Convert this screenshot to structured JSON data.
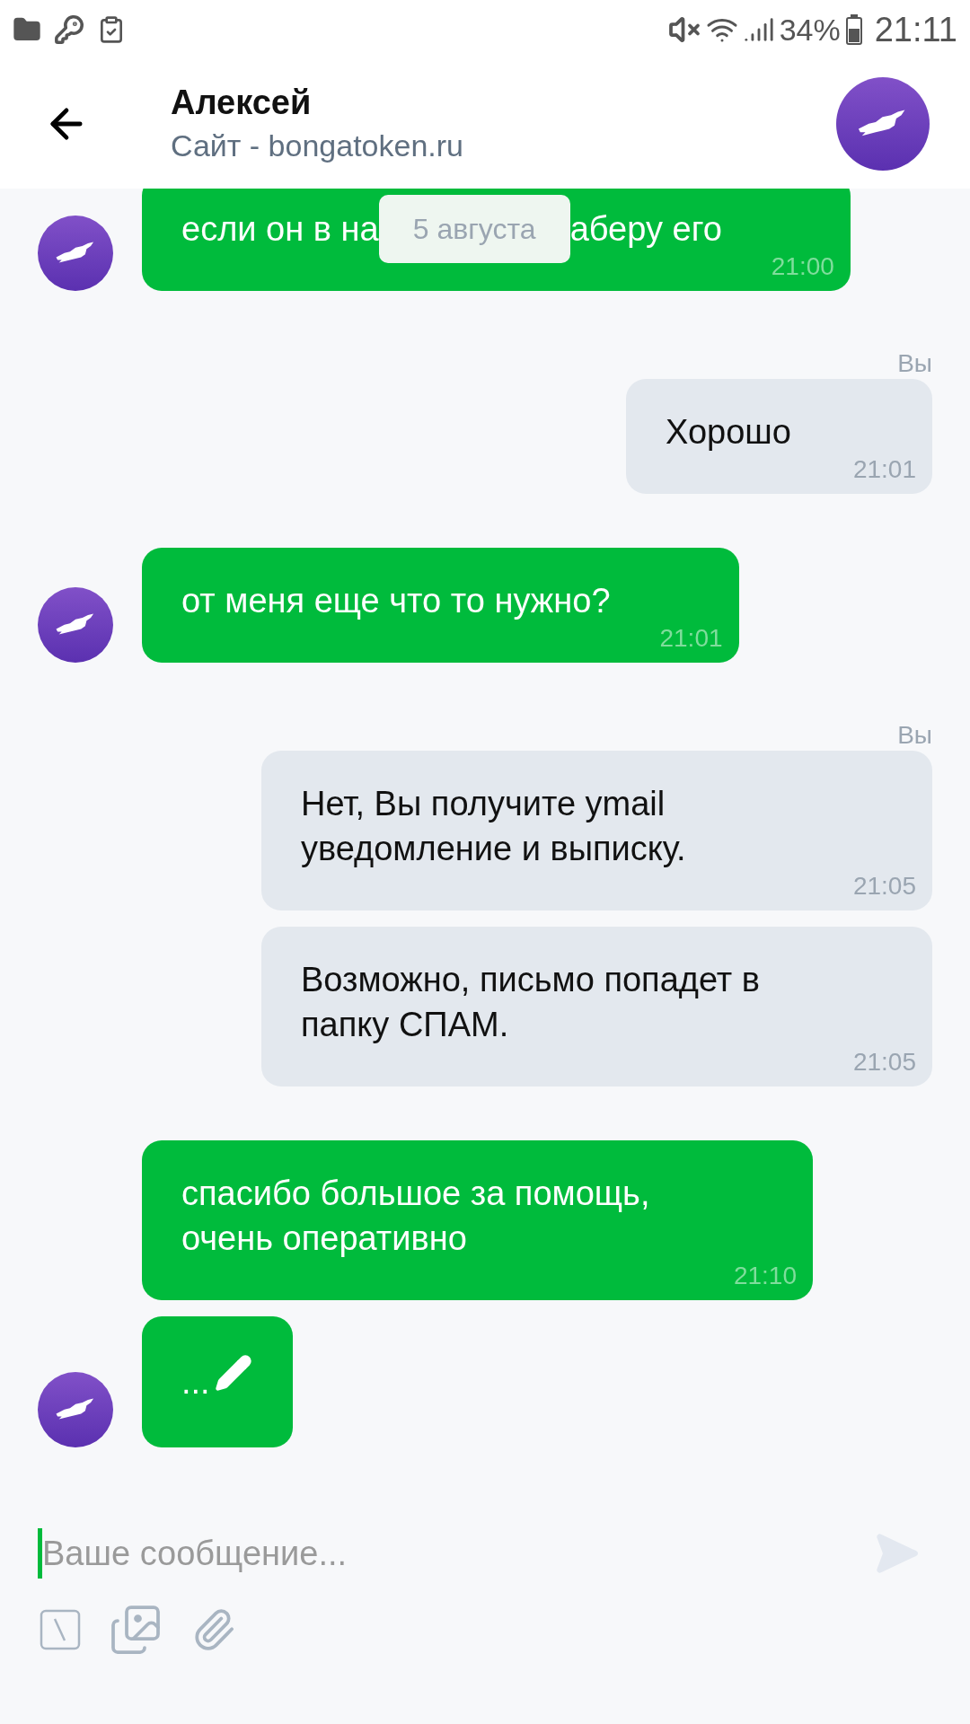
{
  "status_bar": {
    "battery": "34%",
    "time": "21:11"
  },
  "header": {
    "name": "Алексей",
    "subtitle": "Сайт - bongatoken.ru"
  },
  "date_chip": "5 августа",
  "messages": [
    {
      "kind": "incoming",
      "text_parts": [
        "если он в на",
        "аберу его"
      ],
      "time": "21:00",
      "avatar": true
    },
    {
      "kind": "outgoing",
      "sender": "Вы",
      "text": "Хорошо",
      "time": "21:01"
    },
    {
      "kind": "incoming",
      "text": "от меня еще что то нужно?",
      "time": "21:01",
      "avatar": true
    },
    {
      "kind": "outgoing",
      "sender": "Вы",
      "text": "Нет, Вы получите ymail уведомление и выписку.",
      "time": "21:05"
    },
    {
      "kind": "outgoing",
      "text": "Возможно, письмо попадет в папку СПАМ.",
      "time": "21:05"
    },
    {
      "kind": "incoming",
      "text": "спасибо большое за помощь, очень оперативно",
      "time": "21:10",
      "avatar": false
    },
    {
      "kind": "typing",
      "text": "...",
      "avatar": true
    }
  ],
  "composer": {
    "placeholder": "Ваше сообщение..."
  }
}
